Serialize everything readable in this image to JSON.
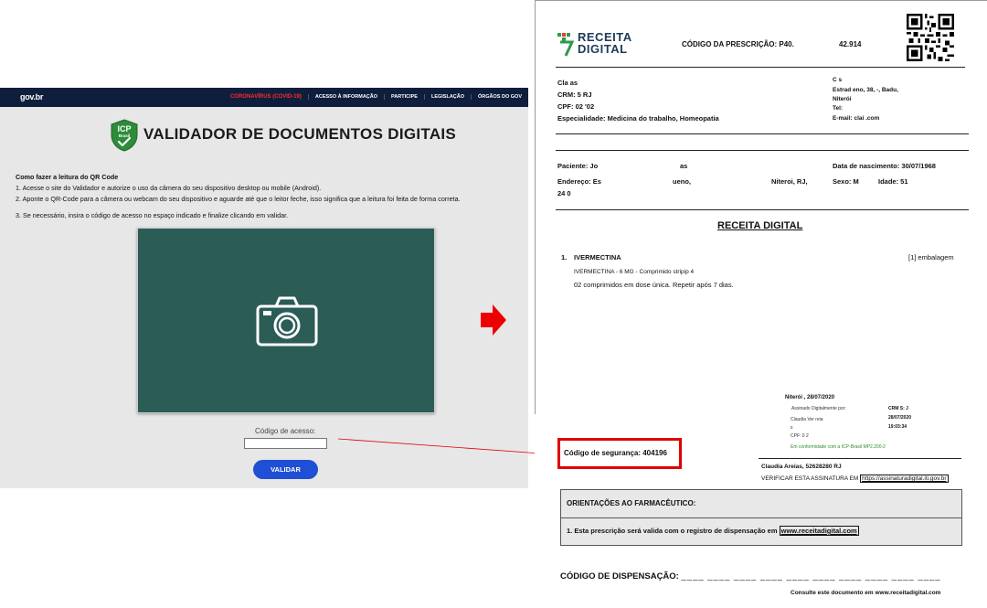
{
  "validator": {
    "gov_logo": "gov.br",
    "gov_links": [
      "CORONAVÍRUS (COVID-19)",
      "ACESSO À INFORMAÇÃO",
      "PARTICIPE",
      "LEGISLAÇÃO",
      "ÓRGÃOS DO GOV"
    ],
    "badge_text": "ICP Brasil",
    "title": "VALIDADOR DE DOCUMENTOS DIGITAIS",
    "instructions_heading": "Como fazer a leitura do QR Code",
    "instruction_1": "1. Acesse o site do Validador e autorize o uso da câmera do seu dispositivo desktop ou mobile (Android).",
    "instruction_2": "2. Aponte o QR-Code para a câmera ou webcam do seu dispositivo e aguarde até que o leitor feche, isso significa que a leitura foi feita de forma correta.",
    "instruction_3": "3. Se necessário, insira o código de acesso no espaço indicado e finalize clicando em validar.",
    "code_label": "Código de acesso:",
    "code_value": "",
    "validate_button": "VALIDAR",
    "camera_icon": "camera-icon"
  },
  "prescription": {
    "logo_line1": "RECEITA",
    "logo_line2": "DIGITAL",
    "code_label": "CÓDIGO DA PRESCRIÇÃO:  P40.",
    "code_value": "42.914",
    "doctor": {
      "name": "Cla                  as",
      "crm": "CRM: 5              RJ",
      "cpf": "CPF: 02              '02",
      "specialty": "Especialidade: Medicina do trabalho, Homeopatia"
    },
    "address": {
      "line1": "C                   s",
      "line2": "Estrad                              eno, 38, -, Badu,",
      "line3": "Niterói",
      "line4": "Tel:",
      "line5": "E-mail: clai                          .com"
    },
    "patient": {
      "name_label": "Paciente: Jo",
      "name_rest": "as",
      "dob": "Data de nascimento: 30/07/1968",
      "address_label": "Endereço: Es",
      "address_mid": "ueno,",
      "address_city": "Niteroi, RJ,",
      "sex": "Sexo: M",
      "age": "Idade: 51",
      "address_line2": "24         0"
    },
    "title": "RECEITA DIGITAL",
    "item_number": "1.",
    "item_name": "IVERMECTINA",
    "item_qty": "[1] embalagem",
    "item_detail": "IVERMECTINA - 6 MG - Comprimido stripip 4",
    "item_dosage": "02 comprimidos em dose única. Repetir após 7 dias.",
    "sign_place_date": "Niterói , 28/07/2020",
    "sig_assinado": "Assinado Digitalmente por:",
    "sig_name": "Claudia Ver                    reia",
    "sig_s": "s",
    "sig_cpf": "CPF: 0              2",
    "sig_conf": "Em conformidade com a ICP-Brasil MP2.200-2",
    "sig_crm": "CRM S:          J",
    "sig_date": "28/07/2020",
    "sig_time": "19:03:34",
    "signer": "Claudia Areias, 52628280 RJ",
    "verify_text": "VERIFICAR ESTA ASSINATURA EM",
    "verify_url": "https://assinaturadigital.iti.gov.br",
    "security_code": "Código de segurança: 404196",
    "orient_title": "ORIENTAÇÕES AO FARMACÊUTICO:",
    "orient_item_text": "1. Esta prescrição será valida com o registro de dispensação em",
    "orient_item_url": "www.receitadigital.com",
    "dispensation_label": "CÓDIGO DE DISPENSAÇÃO:",
    "consulte": "Consulte este documento em www.receitadigital.com"
  },
  "colors": {
    "gov_bar": "#0f1e3d",
    "validate_button": "#1f4fd4",
    "camera_panel": "#2b5c56",
    "highlight_red": "#e00000",
    "icp_green": "#2e8b3a"
  }
}
